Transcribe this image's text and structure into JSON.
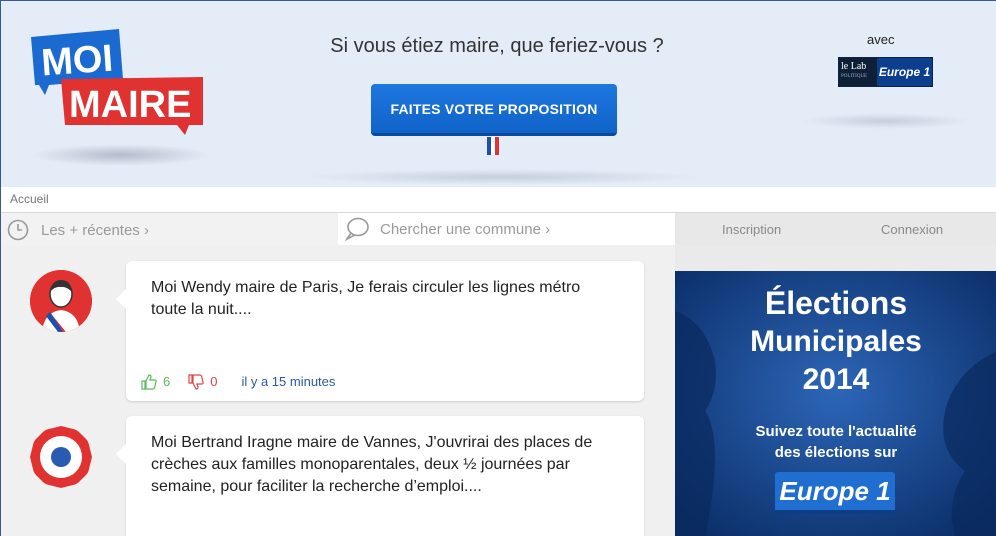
{
  "header": {
    "logo_line1": "MOI",
    "logo_line2": "MAIRE",
    "question": "Si vous étiez maire, que feriez-vous ?",
    "cta_label": "FAITES VOTRE PROPOSITION",
    "avec_label": "avec",
    "partner_lab_label": "le Lab",
    "partner_lab_sub": "POLITIQUE",
    "partner_europe1_label": "Europe 1"
  },
  "breadcrumb": {
    "home": "Accueil"
  },
  "nav": {
    "recent_label": "Les + récentes ›",
    "search_placeholder": "Chercher une commune ›",
    "signup_label": "Inscription",
    "login_label": "Connexion"
  },
  "posts": [
    {
      "text": "Moi Wendy maire de Paris, Je ferais circuler les lignes métro toute la nuit....",
      "likes": "6",
      "dislikes": "0",
      "time": "il y a 15 minutes"
    },
    {
      "text": "Moi Bertrand Iragne maire de Vannes, J'ouvrirai des places de crèches aux familles monoparentales, deux ½ journées par semaine, pour faciliter la recherche d’emploi...."
    }
  ],
  "ad": {
    "title_line1": "Élections",
    "title_line2": "Municipales",
    "title_line3": "2014",
    "subtitle_line1": "Suivez toute l'actualité",
    "subtitle_line2": "des élections sur",
    "brand": "Europe 1"
  },
  "colors": {
    "header_bg": "#e4ecf7",
    "cta_blue": "#1668d4",
    "logo_blue": "#1a6ad2",
    "logo_red": "#e03231",
    "like_green": "#5cb85c",
    "dislike_red": "#e04444",
    "time_link": "#2a5aa6",
    "ad_bg": "#0d3a7a"
  }
}
